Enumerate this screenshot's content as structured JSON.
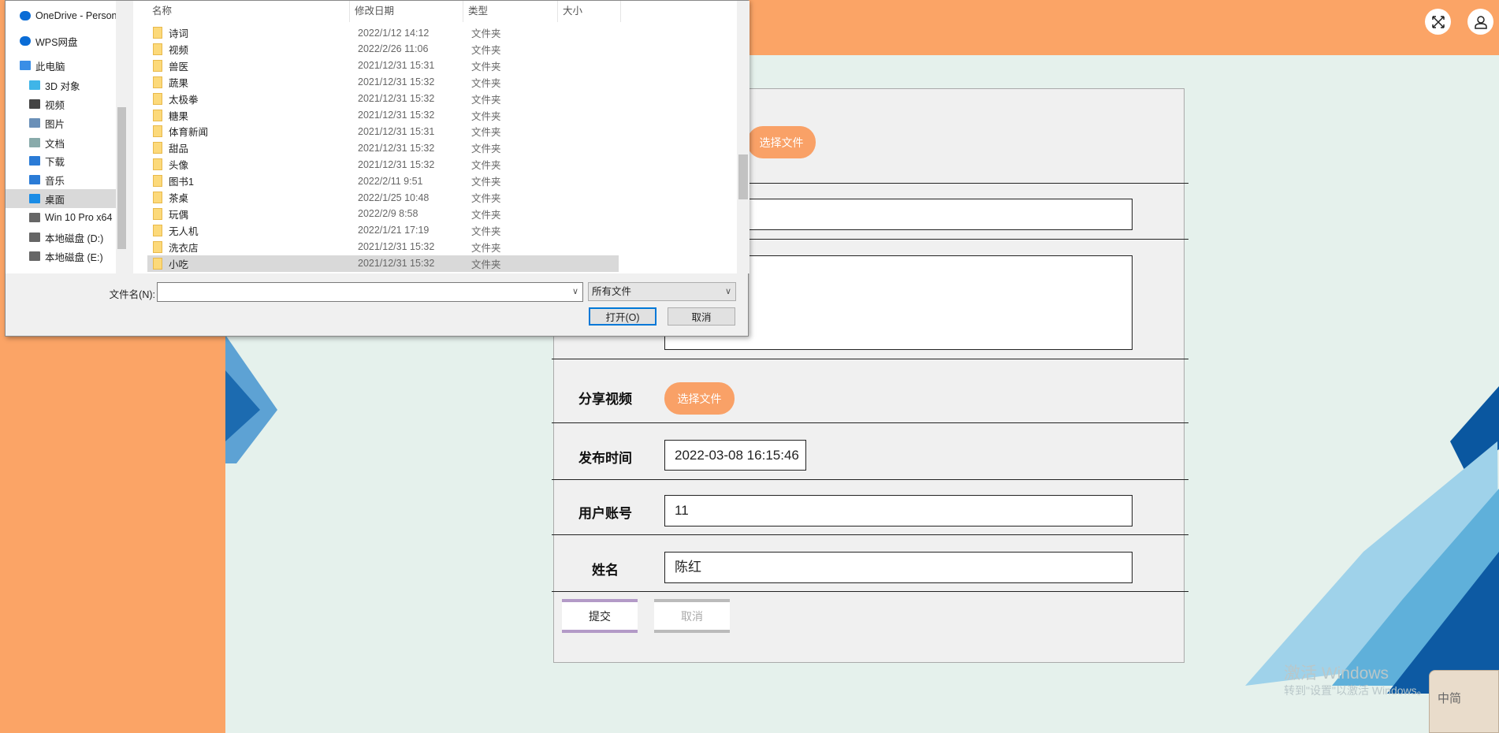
{
  "header": {
    "fullscreen_icon": "expand-icon",
    "user_icon": "user-icon"
  },
  "form": {
    "select_file_label": "选择文件",
    "video_label": "分享视频",
    "video_button": "选择文件",
    "time_label": "发布时间",
    "time_value": "2022-03-08 16:15:46",
    "account_label": "用户账号",
    "account_value": "11",
    "name_label": "姓名",
    "name_value": "陈红",
    "submit": "提交",
    "cancel": "取消"
  },
  "watermark": {
    "line1": "激活 Windows",
    "line2": "转到\"设置\"以激活 Windows。"
  },
  "ime": {
    "label": "中简"
  },
  "dialog": {
    "nav": [
      {
        "label": "OneDrive - Personal",
        "icon": "cloud-icon"
      },
      {
        "label": "WPS网盘",
        "icon": "cloud-icon"
      },
      {
        "label": "此电脑",
        "icon": "computer-icon"
      },
      {
        "label": "3D 对象",
        "icon": "cube-icon"
      },
      {
        "label": "视频",
        "icon": "film-icon"
      },
      {
        "label": "图片",
        "icon": "picture-icon"
      },
      {
        "label": "文档",
        "icon": "document-icon"
      },
      {
        "label": "下载",
        "icon": "download-icon"
      },
      {
        "label": "音乐",
        "icon": "music-icon"
      },
      {
        "label": "桌面",
        "icon": "desktop-icon"
      },
      {
        "label": "Win 10 Pro x64",
        "icon": "drive-icon"
      },
      {
        "label": "本地磁盘 (D:)",
        "icon": "drive-icon"
      },
      {
        "label": "本地磁盘 (E:)",
        "icon": "drive-icon"
      }
    ],
    "columns": [
      "名称",
      "修改日期",
      "类型",
      "大小"
    ],
    "rows": [
      {
        "name": "诗词",
        "date": "2022/1/12 14:12",
        "type": "文件夹"
      },
      {
        "name": "视频",
        "date": "2022/2/26 11:06",
        "type": "文件夹"
      },
      {
        "name": "兽医",
        "date": "2021/12/31 15:31",
        "type": "文件夹"
      },
      {
        "name": "蔬果",
        "date": "2021/12/31 15:32",
        "type": "文件夹"
      },
      {
        "name": "太极拳",
        "date": "2021/12/31 15:32",
        "type": "文件夹"
      },
      {
        "name": "糖果",
        "date": "2021/12/31 15:32",
        "type": "文件夹"
      },
      {
        "name": "体育新闻",
        "date": "2021/12/31 15:31",
        "type": "文件夹"
      },
      {
        "name": "甜品",
        "date": "2021/12/31 15:32",
        "type": "文件夹"
      },
      {
        "name": "头像",
        "date": "2021/12/31 15:32",
        "type": "文件夹"
      },
      {
        "name": "图书1",
        "date": "2022/2/11 9:51",
        "type": "文件夹"
      },
      {
        "name": "茶桌",
        "date": "2022/1/25 10:48",
        "type": "文件夹"
      },
      {
        "name": "玩偶",
        "date": "2022/2/9 8:58",
        "type": "文件夹"
      },
      {
        "name": "无人机",
        "date": "2022/1/21 17:19",
        "type": "文件夹"
      },
      {
        "name": "洗衣店",
        "date": "2021/12/31 15:32",
        "type": "文件夹"
      },
      {
        "name": "小吃",
        "date": "2021/12/31 15:32",
        "type": "文件夹"
      }
    ],
    "filename_label": "文件名(N):",
    "filename_value": "",
    "filter": "所有文件",
    "open": "打开(O)",
    "cancel": "取消"
  }
}
